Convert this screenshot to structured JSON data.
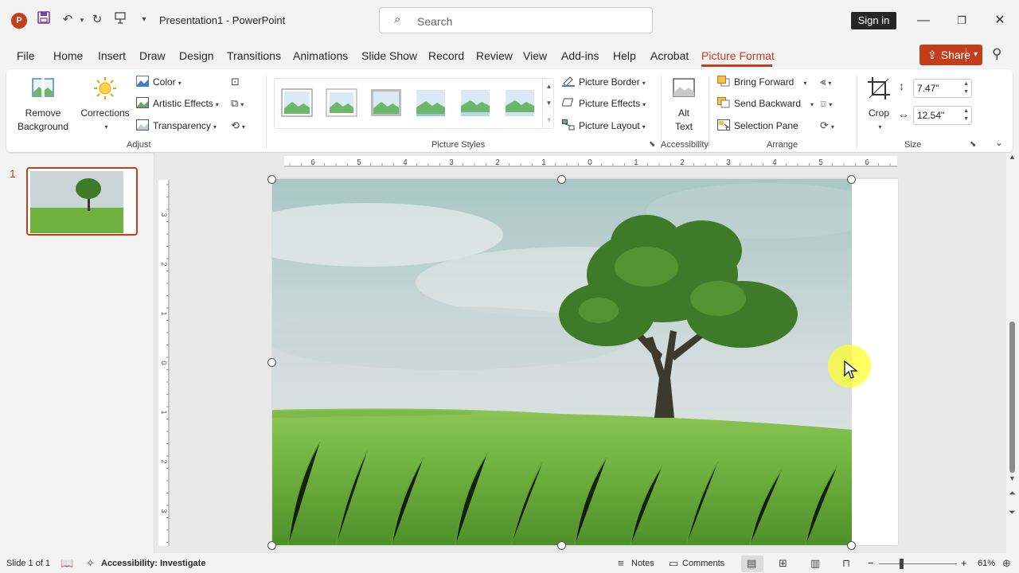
{
  "titlebar": {
    "doc_title": "Presentation1  -  PowerPoint",
    "search_placeholder": "Search",
    "sign_in": "Sign in",
    "app_icon": "P"
  },
  "tabs": [
    "File",
    "Home",
    "Insert",
    "Draw",
    "Design",
    "Transitions",
    "Animations",
    "Slide Show",
    "Record",
    "Review",
    "View",
    "Add-ins",
    "Help",
    "Acrobat",
    "Picture Format"
  ],
  "active_tab": "Picture Format",
  "share_label": "Share",
  "ribbon": {
    "remove_background": "Remove Background",
    "corrections": "Corrections",
    "color": "Color",
    "artistic_effects": "Artistic Effects",
    "transparency": "Transparency",
    "picture_border": "Picture Border",
    "picture_effects": "Picture Effects",
    "picture_layout": "Picture Layout",
    "alt_text_1": "Alt",
    "alt_text_2": "Text",
    "bring_forward": "Bring Forward",
    "send_backward": "Send Backward",
    "selection_pane": "Selection Pane",
    "crop": "Crop",
    "height": "7.47\"",
    "width": "12.54\"",
    "groups": {
      "adjust": "Adjust",
      "picture_styles": "Picture Styles",
      "accessibility": "Accessibility",
      "arrange": "Arrange",
      "size": "Size"
    }
  },
  "slides_panel": {
    "slide_number": "1"
  },
  "ruler": {
    "h_ticks": [
      "6",
      "5",
      "4",
      "3",
      "2",
      "1",
      "0",
      "1",
      "2",
      "3",
      "4",
      "5",
      "6"
    ],
    "v_ticks": [
      "3",
      "2",
      "1",
      "0",
      "1",
      "2",
      "3"
    ]
  },
  "status": {
    "slide_info": "Slide 1 of 1",
    "accessibility": "Accessibility: Investigate",
    "notes": "Notes",
    "comments": "Comments",
    "zoom": "61%"
  },
  "colors": {
    "accent": "#c43e1c"
  }
}
